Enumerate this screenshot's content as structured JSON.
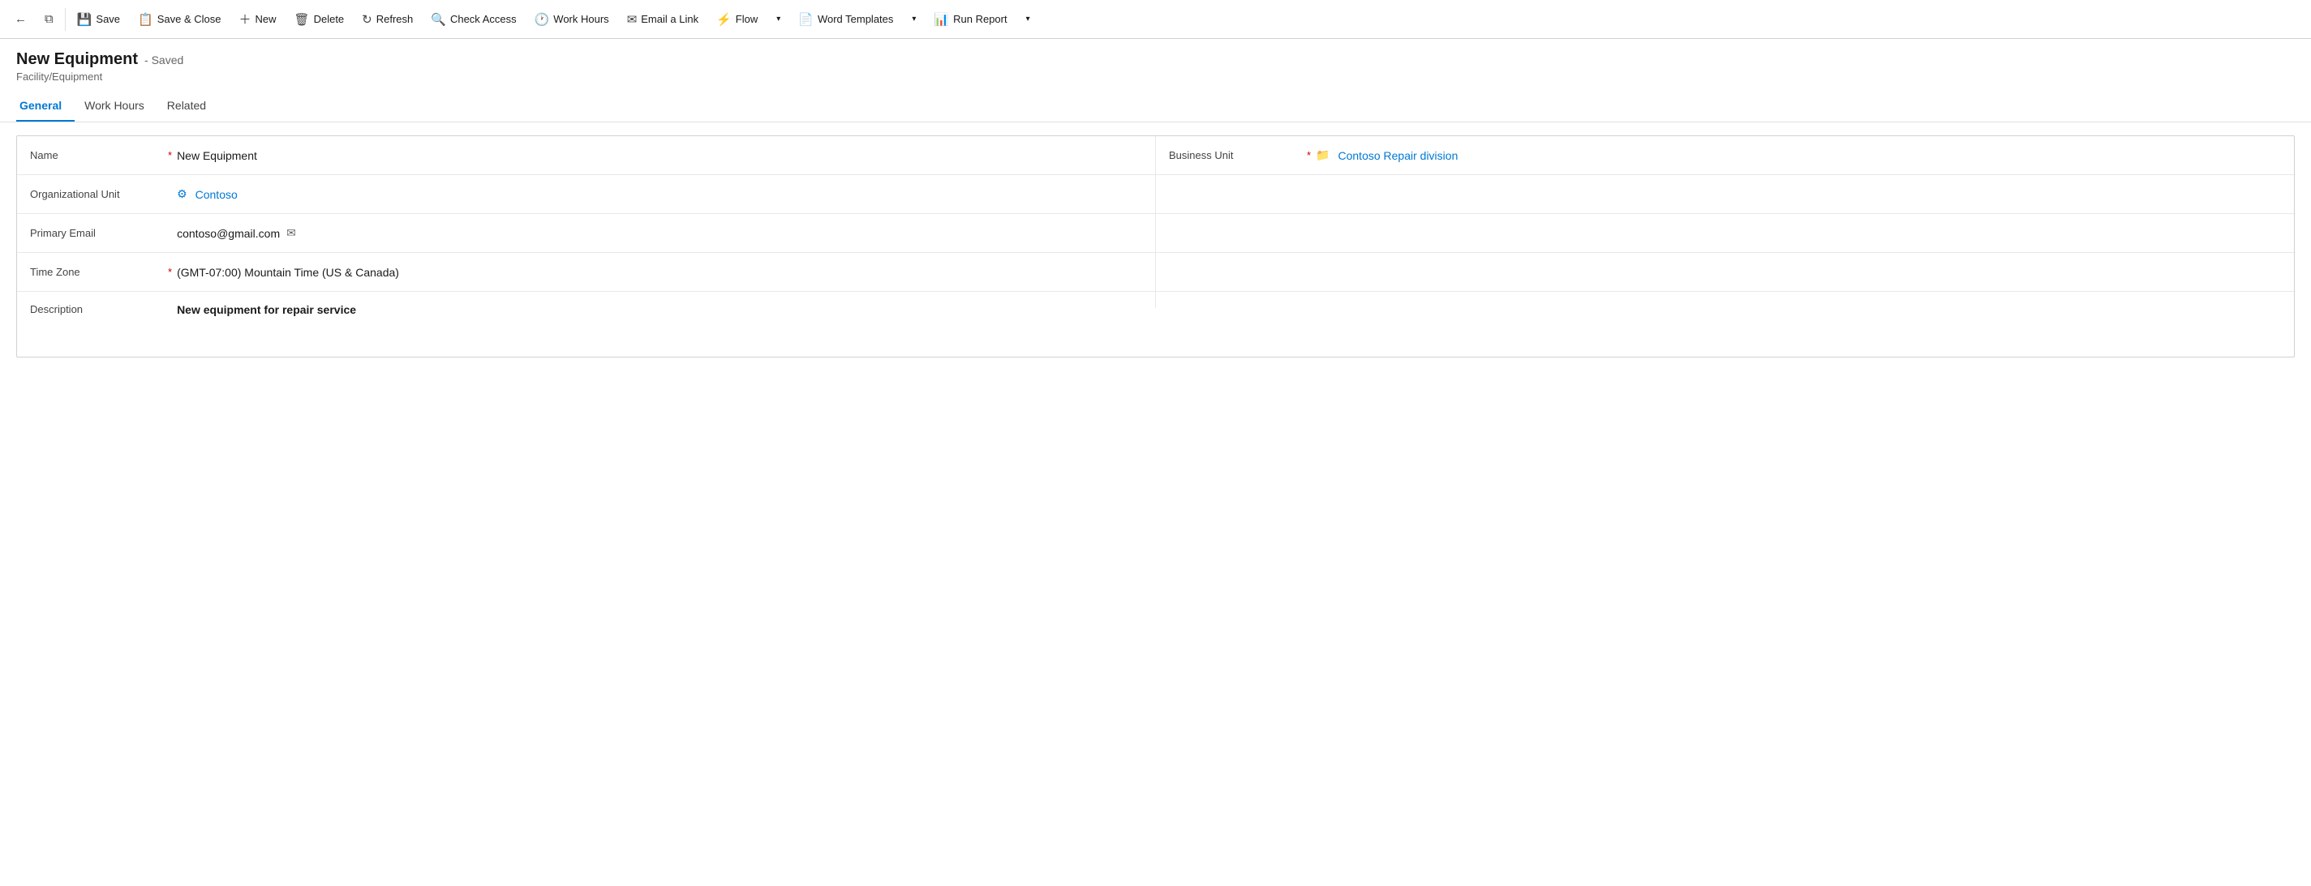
{
  "toolbar": {
    "back_label": "←",
    "window_label": "⧉",
    "save_label": "Save",
    "save_close_label": "Save & Close",
    "new_label": "New",
    "delete_label": "Delete",
    "refresh_label": "Refresh",
    "check_access_label": "Check Access",
    "work_hours_label": "Work Hours",
    "email_link_label": "Email a Link",
    "flow_label": "Flow",
    "word_templates_label": "Word Templates",
    "run_report_label": "Run Report"
  },
  "page": {
    "title": "New Equipment",
    "saved_status": "- Saved",
    "subtitle": "Facility/Equipment"
  },
  "tabs": [
    {
      "id": "general",
      "label": "General",
      "active": true
    },
    {
      "id": "work_hours",
      "label": "Work Hours",
      "active": false
    },
    {
      "id": "related",
      "label": "Related",
      "active": false
    }
  ],
  "form": {
    "name_label": "Name",
    "name_required": "*",
    "name_value": "New Equipment",
    "business_unit_label": "Business Unit",
    "business_unit_required": "*",
    "business_unit_value": "Contoso Repair division",
    "org_unit_label": "Organizational Unit",
    "org_unit_value": "Contoso",
    "primary_email_label": "Primary Email",
    "primary_email_value": "contoso@gmail.com",
    "time_zone_label": "Time Zone",
    "time_zone_required": "*",
    "time_zone_value": "(GMT-07:00) Mountain Time (US & Canada)",
    "description_label": "Description",
    "description_value": "New equipment for repair service"
  }
}
